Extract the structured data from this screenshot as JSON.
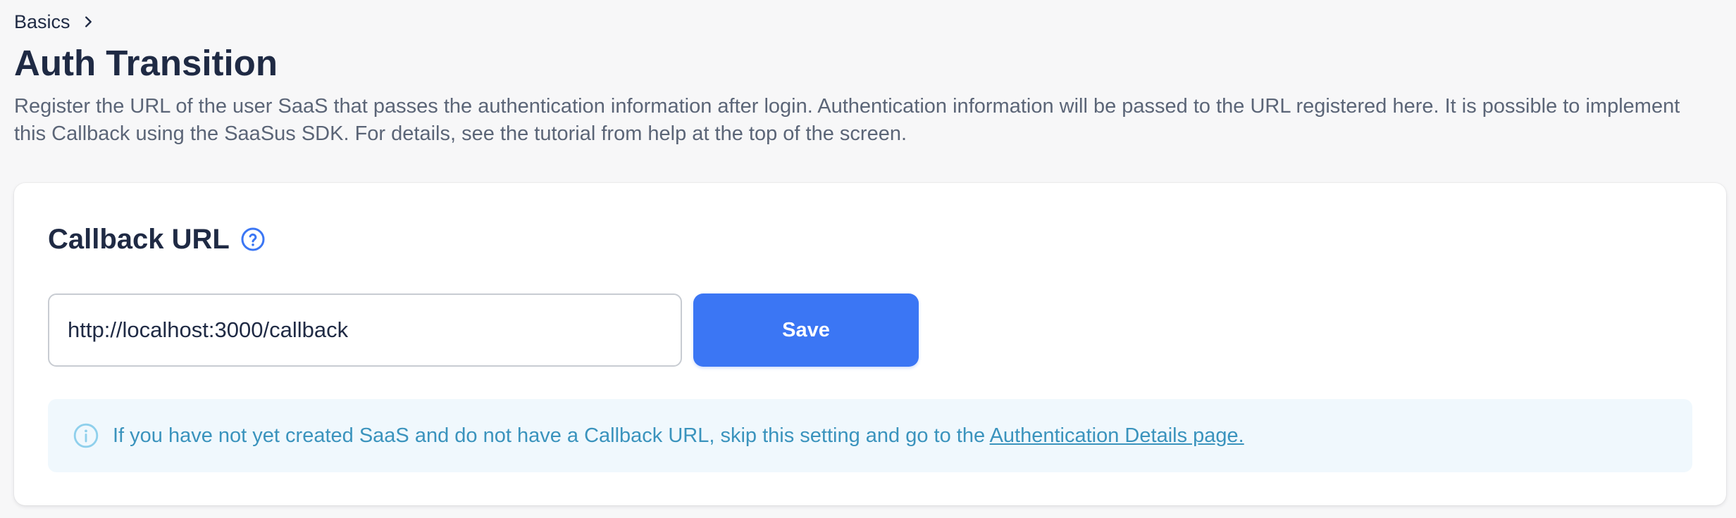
{
  "breadcrumb": {
    "items": [
      "Basics"
    ],
    "separator_icon": "chevron-right-icon"
  },
  "page": {
    "title": "Auth Transition",
    "description": "Register the URL of the user SaaS that passes the authentication information after login. Authentication information will be passed to the URL registered here. It is possible to implement this Callback using the SaaSus SDK. For details, see the tutorial from help at the top of the screen."
  },
  "callback": {
    "title": "Callback URL",
    "help_icon": "question-circle-icon",
    "url_value": "http://localhost:3000/callback",
    "save_label": "Save"
  },
  "info": {
    "icon": "info-circle-icon",
    "text": "If you have not yet created SaaS and do not have a Callback URL, skip this setting and go to the ",
    "link_text": "Authentication Details page."
  },
  "colors": {
    "background": "#f7f7f8",
    "card": "#ffffff",
    "primary_text": "#1f2a44",
    "secondary_text": "#5b6577",
    "accent": "#3b76f4",
    "info_bg": "#f0f8fd",
    "info_text": "#3a93bd"
  }
}
